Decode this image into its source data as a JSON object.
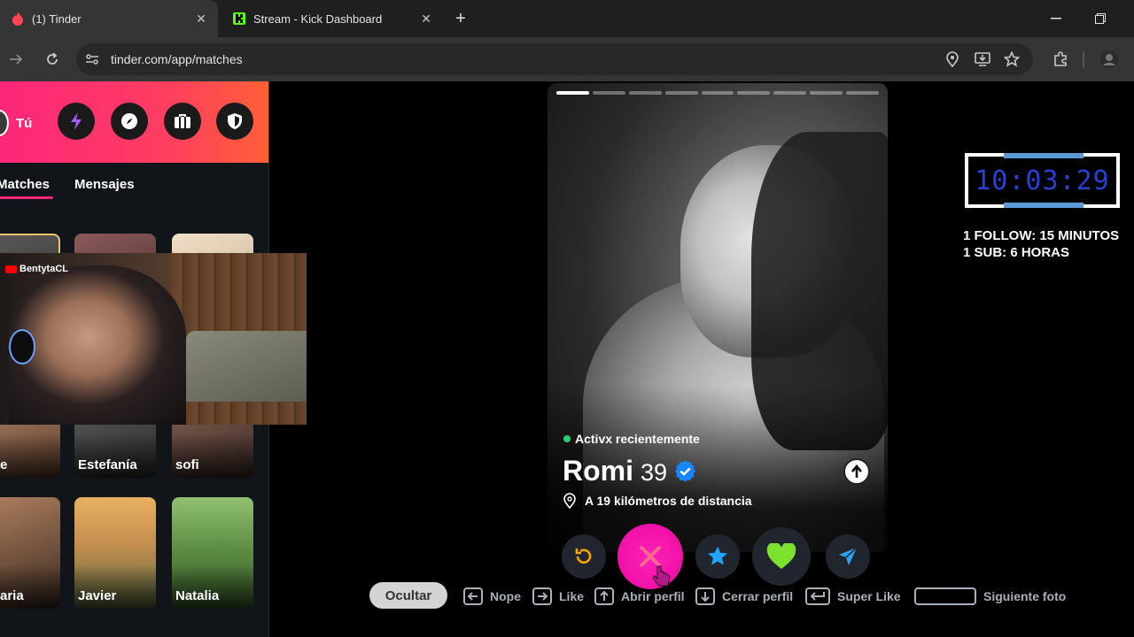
{
  "browser": {
    "tabs": [
      {
        "title": "(1) Tinder",
        "icon": "tinder-flame-icon",
        "active": true
      },
      {
        "title": "Stream - Kick Dashboard",
        "icon": "kick-logo-icon",
        "active": false
      }
    ],
    "url": "tinder.com/app/matches"
  },
  "sidebar": {
    "me_label": "Tú",
    "tabs": [
      "Matches",
      "Mensajes"
    ],
    "matches": [
      {
        "name": "e"
      },
      {
        "name": "Estefanía"
      },
      {
        "name": "sofi"
      },
      {
        "name": "aria"
      },
      {
        "name": "Javier"
      },
      {
        "name": "Natalia"
      }
    ]
  },
  "webcam": {
    "label": "BentytaCL"
  },
  "profile": {
    "status": "Activx recientemente",
    "name": "Romi",
    "age": "39",
    "distance": "A 19 kilómetros de distancia",
    "photo_count": 9,
    "current_photo": 1
  },
  "hints": {
    "hide": "Ocultar",
    "nope": "Nope",
    "like": "Like",
    "open": "Abrir perfil",
    "close": "Cerrar perfil",
    "superlike": "Super Like",
    "next": "Siguiente foto"
  },
  "overlay": {
    "timer": "10:03:29",
    "line1": "1 FOLLOW: 15 MINUTOS",
    "line2": "1 SUB: 6 HORAS"
  },
  "colors": {
    "brand": "#fd267a",
    "active": "#21d07a",
    "verified": "#1786ff"
  }
}
